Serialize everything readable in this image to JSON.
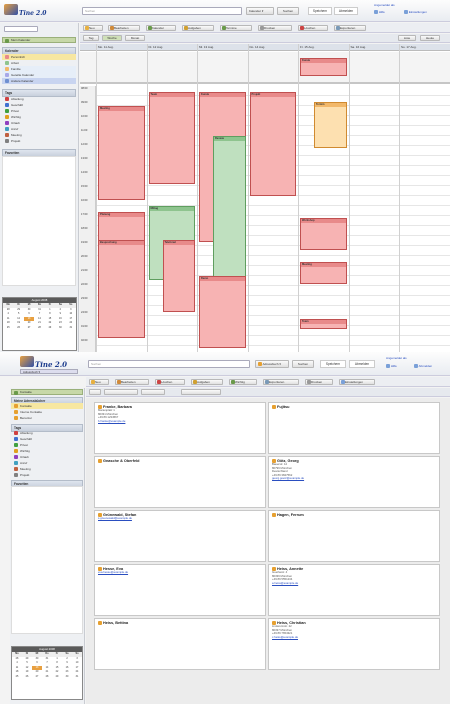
{
  "top": {
    "app_title": "Tine 2.0",
    "search_placeholder": "Suchen",
    "select_label": "Kalender",
    "search_button": "Suchen",
    "login_buttons": [
      "Speichern",
      "Abmelden"
    ],
    "user_label": "Angemeldet als",
    "user_links": [
      "Hilfe",
      "Einstellungen"
    ],
    "toolbar": [
      "Neu",
      "Bearbeiten",
      "Kalender",
      "Aufgaben",
      "Termine",
      "Drucken",
      "Löschen",
      "Exportieren"
    ],
    "view_toolbar": [
      "Tag",
      "Woche",
      "Monat",
      "Liste",
      "Heute"
    ],
    "sidebar_head": "Kalender",
    "filter_head": "Mein Kalender",
    "my_items": [
      "Persönlich",
      "Arbeit",
      "Familie",
      "Geteilte Kalender",
      "Andere Kalender"
    ],
    "tags_head": "Tags",
    "tags": [
      "Abteilung",
      "Geschäft",
      "Privat",
      "Wichtig",
      "Urlaub",
      "Anruf",
      "Meeting",
      "Projekt"
    ],
    "saved_head": "Favoriten",
    "day_headers": [
      "Mo. 11 Aug.",
      "Di. 12 Aug.",
      "Mi. 13 Aug.",
      "Do. 14 Aug.",
      "Fr. 15 Aug.",
      "Sa. 16 Aug.",
      "So. 17 Aug."
    ],
    "times": [
      "08:00",
      "09:00",
      "10:00",
      "11:00",
      "12:00",
      "13:00",
      "14:00",
      "15:00",
      "16:00",
      "17:00",
      "18:00",
      "19:00",
      "20:00",
      "21:00",
      "22:00",
      "23:00",
      "24:00",
      "01:00",
      "02:00"
    ],
    "mini_title": "August 2008",
    "mini_days": [
      "Mo",
      "Di",
      "Mi",
      "Do",
      "Fr",
      "Sa",
      "So"
    ],
    "events": [
      "Meeting",
      "Team",
      "Kunde",
      "Projekt",
      "Termin",
      "Review",
      "Mittag",
      "Telefonat",
      "Planung",
      "Besprechung",
      "Demo",
      "Workshop"
    ]
  },
  "bottom": {
    "app_title": "Tine 2.0",
    "search_placeholder": "Suchen",
    "select_label": "Adressbuch",
    "search_button": "Suchen",
    "login_buttons": [
      "Speichern",
      "Abmelden"
    ],
    "user_label": "Angemeldet als",
    "user_links": [
      "Hilfe",
      "Abmelden"
    ],
    "toolbar": [
      "Neu",
      "Bearbeiten",
      "Löschen",
      "Aufgaben",
      "Wichtig",
      "Exportieren",
      "Drucken",
      "Einstellungen"
    ],
    "side_tab": "Kontakte",
    "side_heads": [
      "Meine Adressbücher",
      "Tags",
      "Favoriten"
    ],
    "books": [
      "Kontakte",
      "Interne Kontakte",
      "Benutzer"
    ],
    "tags": [
      "Abteilung",
      "Geschäft",
      "Privat",
      "Wichtig",
      "Urlaub",
      "Anruf",
      "Meeting",
      "Projekt"
    ],
    "mini_title": "August 2008",
    "mini_days": [
      "Mo",
      "Di",
      "Mi",
      "Do",
      "Fr",
      "Sa",
      "So"
    ],
    "contacts": [
      {
        "name": "Franke, Barbara",
        "lines": [
          "Marienplatz 1",
          "80331 München",
          "+49 89 1234567",
          "b.franke@example.de"
        ]
      },
      {
        "name": "Fujitsu",
        "lines": []
      },
      {
        "name": "Gnasche & Oberfeld",
        "lines": []
      },
      {
        "name": "Götz, Georg",
        "lines": [
          "Bauerstr. 12",
          "80796 München",
          "Deutschland",
          "+49 89 3847562",
          "georg.goetz@example.de"
        ]
      },
      {
        "name": "Grünewald, Stefan",
        "lines": [
          "s.gruenewald@example.de"
        ]
      },
      {
        "name": "Hagen, Ferrum",
        "lines": []
      },
      {
        "name": "Hesse, Eva",
        "lines": [
          "eva.hesse@example.de"
        ]
      },
      {
        "name": "Heiss, Annette",
        "lines": [
          "Goethestr. 4",
          "80336 München",
          "+49 89 5551234",
          "a.heiss@example.de"
        ]
      },
      {
        "name": "Heiss, Bettina",
        "lines": []
      },
      {
        "name": "Heiss, Christian",
        "lines": [
          "Lindwurmstr. 22",
          "80337 München",
          "+49 89 7654321",
          "c.heiss@example.de"
        ]
      }
    ]
  }
}
